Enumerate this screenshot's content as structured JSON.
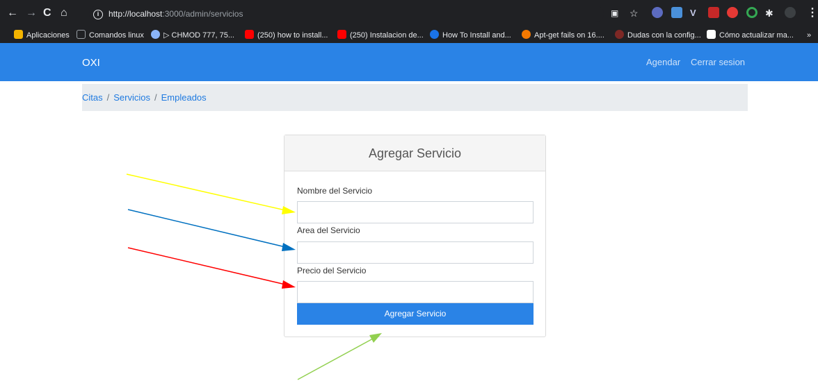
{
  "browser": {
    "url_host": "http://localhost",
    "url_path": ":3000/admin/servicios",
    "info_icon": "i",
    "bookmarks": [
      {
        "label": "Aplicaciones",
        "icon": "apps-grid-icon",
        "color": "#f4b400"
      },
      {
        "label": "Comandos linux",
        "icon": "bookmark-icon",
        "color": "#5f6368"
      },
      {
        "label": "▷ CHMOD 777, 75...",
        "icon": "globe-icon",
        "color": "#8ab4f8"
      },
      {
        "label": "(250) how to install...",
        "icon": "youtube-icon",
        "color": "#ff0000"
      },
      {
        "label": "(250) Instalacion de...",
        "icon": "youtube-icon",
        "color": "#ff0000"
      },
      {
        "label": "How To Install and...",
        "icon": "digitalocean-icon",
        "color": "#1a73e8"
      },
      {
        "label": "Apt-get fails on 16....",
        "icon": "askubuntu-icon",
        "color": "#f57900"
      },
      {
        "label": "Dudas con la config...",
        "icon": "site-icon",
        "color": "#d93025"
      },
      {
        "label": "Cómo actualizar ma...",
        "icon": "da-icon",
        "color": "#ffffff"
      }
    ],
    "more_bookmarks": "»"
  },
  "navbar": {
    "brand": "OXI",
    "links": [
      "Agendar",
      "Cerrar sesion"
    ]
  },
  "breadcrumb": [
    "Citas",
    "Servicios",
    "Empleados"
  ],
  "form": {
    "title": "Agregar Servicio",
    "fields": [
      {
        "label": "Nombre del Servicio",
        "value": ""
      },
      {
        "label": "Area del Servicio",
        "value": ""
      },
      {
        "label": "Precio del Servicio",
        "value": ""
      }
    ],
    "submit": "Agregar Servicio"
  },
  "annotations": {
    "arrow_colors": [
      "#ffff00",
      "#0070c0",
      "#ff0000",
      "#92d050"
    ]
  }
}
